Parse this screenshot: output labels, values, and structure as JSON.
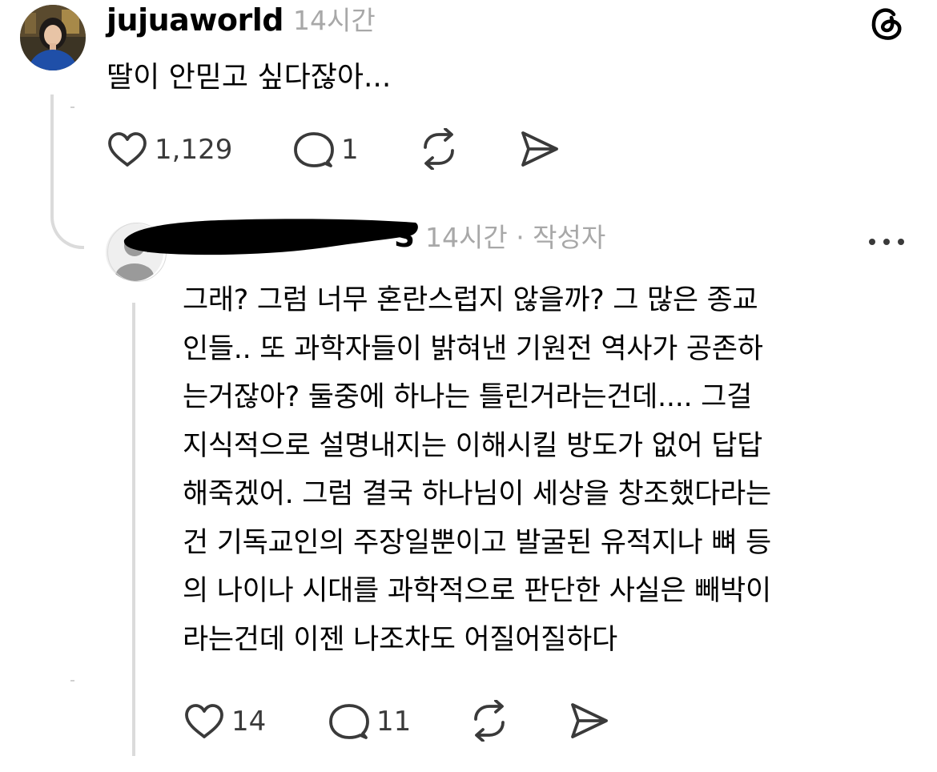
{
  "post": {
    "username": "jujuaworld",
    "timestamp": "14시간",
    "text": "딸이 안믿고 싶다잖아...",
    "likes": "1,129",
    "replies": "1"
  },
  "reply": {
    "username_suffix": "S",
    "timestamp": "14시간 · 작성자",
    "lines": [
      "그래? 그럼 너무 혼란스럽지 않을까? 그 많은 종교",
      "인들.. 또 과학자들이 밝혀낸 기원전 역사가 공존하",
      "는거잖아? 둘중에 하나는 틀린거라는건데.... 그걸",
      "지식적으로 설명내지는 이해시킬 방도가 없어 답답",
      "해죽겠어. 그럼 결국 하나님이 세상을 창조했다라는",
      "건 기독교인의 주장일뿐이고 발굴된 유적지나 뼈 등",
      "의 나이나 시대를 과학적으로 판단한 사실은 빼박이",
      "라는건데 이젠 나조차도 어질어질하다"
    ],
    "likes": "14",
    "replies": "11"
  },
  "icons": {
    "like": "heart-icon",
    "comment": "comment-bubble-icon",
    "repost": "repost-icon",
    "share": "send-icon",
    "logo": "threads-logo-icon",
    "more": "more-dots-icon",
    "redaction": "redaction-mark"
  },
  "colors": {
    "text": "#000000",
    "muted": "#a8a8a8",
    "icon": "#3a3a3a",
    "thread_line": "#dbdbdb"
  }
}
